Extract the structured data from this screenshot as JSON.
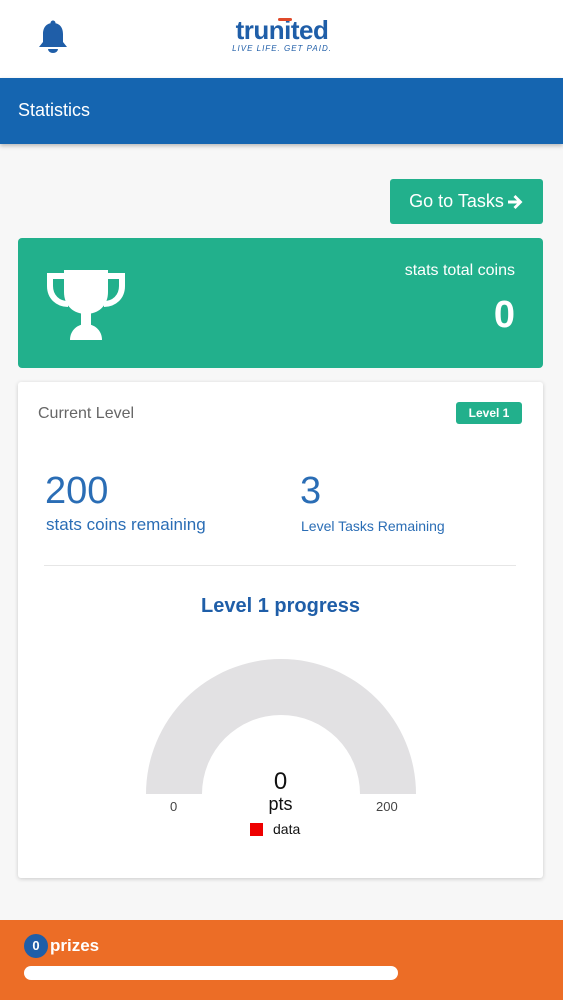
{
  "app": {
    "logo_name": "trunited",
    "logo_tagline": "LIVE LIFE. GET PAID.",
    "bell_icon": "bell-icon",
    "brand_blue": "#1565b0",
    "accent_green": "#22b08c",
    "footer_orange": "#ec6d26"
  },
  "header": {
    "title": "Statistics"
  },
  "actions": {
    "go_to_tasks_label": "Go to Tasks",
    "go_to_tasks_icon": "arrow-right-icon"
  },
  "coins": {
    "label": "stats total coins",
    "value": "0",
    "icon": "trophy-icon"
  },
  "level": {
    "heading": "Current Level",
    "badge": "Level 1",
    "coins_remaining_value": "200",
    "coins_remaining_label": "stats coins remaining",
    "tasks_remaining_value": "3",
    "tasks_remaining_label": "Level Tasks Remaining",
    "progress_title": "Level 1 progress",
    "gauge_value": "0",
    "gauge_unit": "pts",
    "gauge_min": "0",
    "gauge_max": "200",
    "legend_label": "data"
  },
  "chart_data": {
    "type": "gauge",
    "title": "Level 1 progress",
    "value": 0,
    "min": 0,
    "max": 200,
    "unit": "pts",
    "series": [
      {
        "name": "data",
        "color": "#ee0000",
        "values": [
          0
        ]
      }
    ],
    "track_color": "#e2e1e3"
  },
  "footer": {
    "prizes_count": "0",
    "prizes_label": "prizes",
    "prizes_progress_percent": 0
  }
}
